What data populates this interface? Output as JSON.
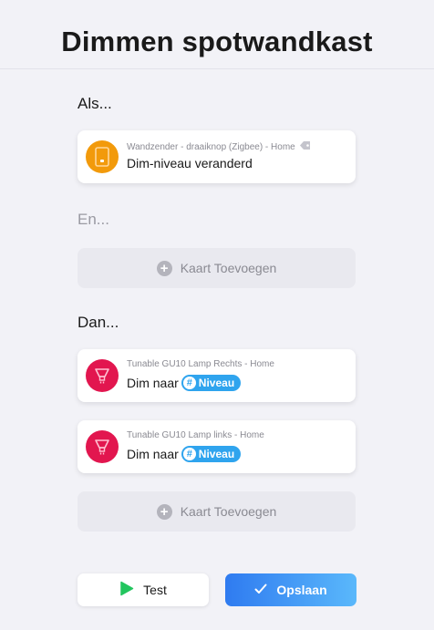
{
  "page": {
    "title": "Dimmen spotwandkast"
  },
  "sections": {
    "when_label": "Als...",
    "and_label": "En...",
    "then_label": "Dan..."
  },
  "when_card": {
    "device": "Wandzender - draaiknop (Zigbee) - Home",
    "text": "Dim-niveau veranderd",
    "icon": "wall-switch-icon",
    "icon_color": "#f29a0b"
  },
  "and_add": {
    "label": "Kaart Toevoegen"
  },
  "then_cards": [
    {
      "device": "Tunable GU10 Lamp Rechts - Home",
      "text": "Dim naar",
      "tag": "Niveau",
      "icon": "spotlight-icon",
      "icon_color": "#e2164f"
    },
    {
      "device": "Tunable GU10 Lamp links - Home",
      "text": "Dim naar",
      "tag": "Niveau",
      "icon": "spotlight-icon",
      "icon_color": "#e2164f"
    }
  ],
  "then_add": {
    "label": "Kaart Toevoegen"
  },
  "footer": {
    "test_label": "Test",
    "save_label": "Opslaan"
  },
  "colors": {
    "accent_start": "#2f7bf0",
    "accent_end": "#5ab8fb",
    "play_green": "#22c55e",
    "tag_blue": "#2fa4ee"
  }
}
